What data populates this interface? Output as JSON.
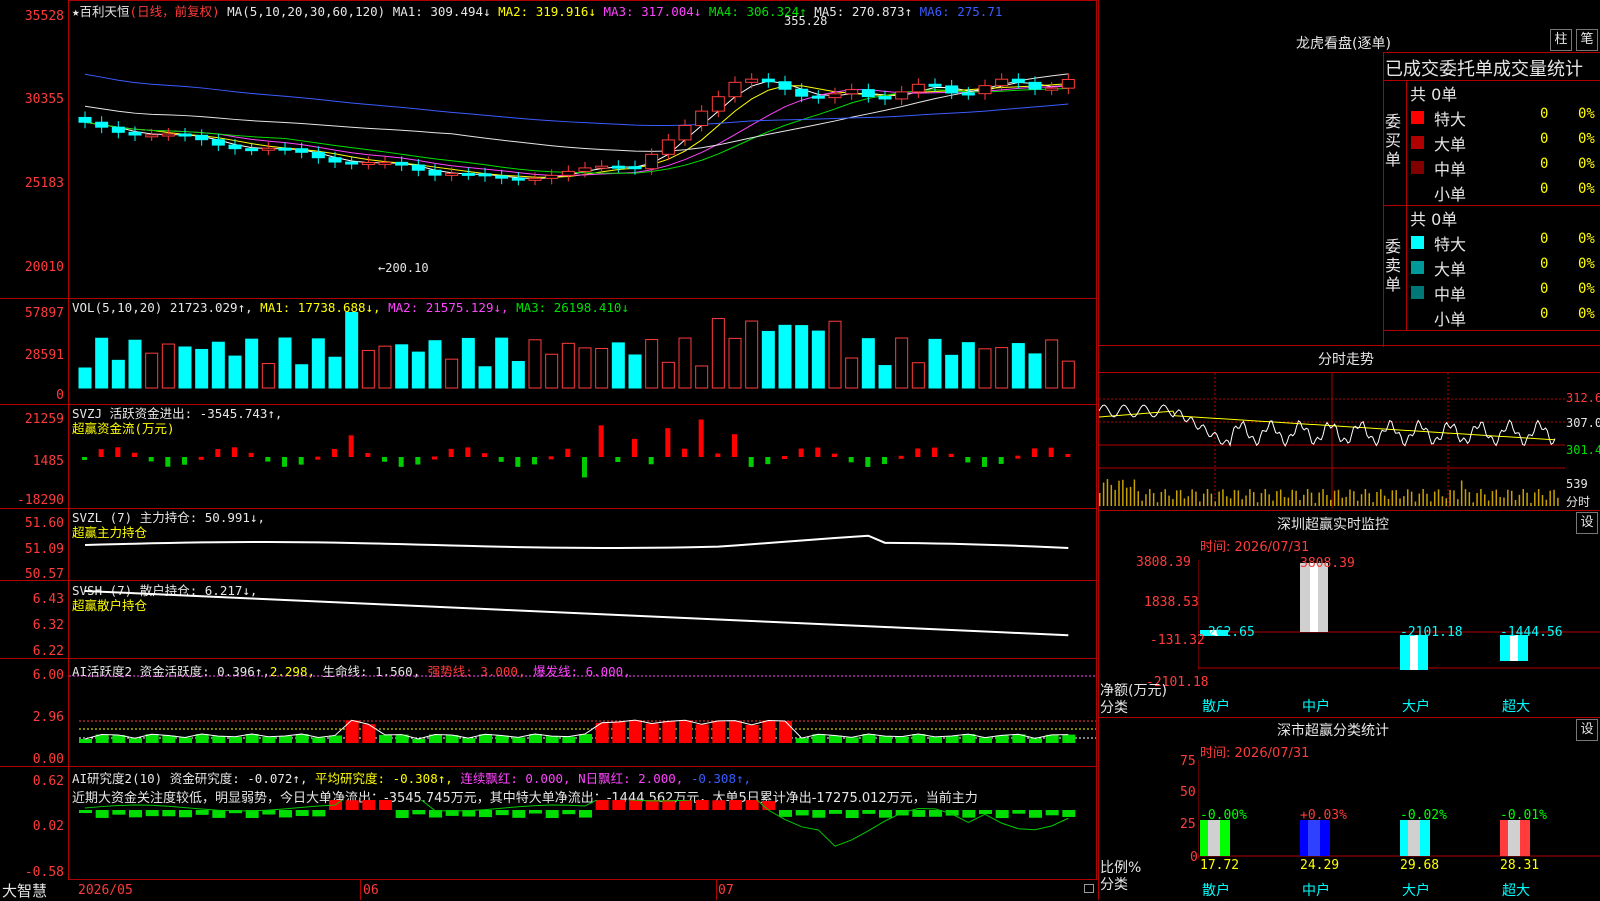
{
  "main": {
    "title": "百利天恒",
    "title_mode": "(日线，前复权)",
    "ma_label": "MA(5,10,20,30,60,120)",
    "ma1": "MA1: 309.494↓",
    "ma2": "MA2: 319.916↓",
    "ma3": "MA3: 317.004↓",
    "ma4": "MA4: 306.324↑",
    "ma5": "MA5: 270.873↑",
    "ma6": "MA6: 275.71",
    "y_ticks": [
      "35528",
      "30355",
      "25183",
      "20010"
    ],
    "high_note": "355.28",
    "low_note": "←200.10"
  },
  "vol": {
    "label": "VOL(5,10,20)",
    "value": "21723.029↑,",
    "ma1": "MA1: 17738.688↓,",
    "ma2": "MA2: 21575.129↓,",
    "ma3": "MA3: 26198.410↓",
    "y_ticks": [
      "57897",
      "28591",
      "0"
    ]
  },
  "svzj": {
    "line1": "SVZJ  活跃资金进出: -3545.743↑,",
    "line2": "超赢资金流(万元)",
    "y_ticks": [
      "21259",
      "1485",
      "-18290"
    ]
  },
  "svzl": {
    "line1": "SVZL (7) 主力持仓: 50.991↓,",
    "line2": "超赢主力持仓",
    "y_ticks": [
      "51.60",
      "51.09",
      "50.57"
    ]
  },
  "svsh": {
    "line1": "SVSH (7) 散户持仓: 6.217↓,",
    "line2": "超赢散户持仓",
    "y_ticks": [
      "6.43",
      "6.32",
      "6.22"
    ]
  },
  "ai1": {
    "name": "AI活跃度2",
    "a": "资金活跃度: 0.396↑,",
    "b": "2.298,",
    "c": "生命线: 1.560,",
    "d": "强势线: 3.000,",
    "e": "爆发线: 6.000,",
    "y_ticks": [
      "6.00",
      "2.96",
      "0.00"
    ]
  },
  "ai2": {
    "name": "AI研究度2(10)",
    "a": "资金研究度: -0.072↑,",
    "b": "平均研究度: -0.308↑,",
    "c": "连续飘红: 0.000,",
    "d": "N日飘红: 2.000,",
    "e": "-0.308↑,",
    "comment": "近期大资金关注度较低，明显弱势，今日大单净流出：-3545.745万元，其中特大单净流出：-1444.562万元，大单5日累计净出-17275.012万元，当前主力",
    "y_ticks": [
      "0.62",
      "0.02",
      "-0.58"
    ]
  },
  "xaxis": {
    "brand": "大智慧",
    "labels": [
      "2026/05",
      "06",
      "07"
    ]
  },
  "dragon": {
    "title": "龙虎看盘(逐单)",
    "btn1": "柱",
    "btn2": "笔",
    "tabs": "已成交委托单成交量统计",
    "buy_side": "委买单",
    "sell_side": "委卖单",
    "buy_total": "共 0单",
    "sell_total": "共 0单",
    "buy_rows": [
      {
        "name": "特大",
        "n": "0",
        "p": "0%"
      },
      {
        "name": "大单",
        "n": "0",
        "p": "0%"
      },
      {
        "name": "中单",
        "n": "0",
        "p": "0%"
      },
      {
        "name": "小单",
        "n": "0",
        "p": "0%"
      }
    ],
    "sell_rows": [
      {
        "name": "特大",
        "n": "0",
        "p": "0%"
      },
      {
        "name": "大单",
        "n": "0",
        "p": "0%"
      },
      {
        "name": "中单",
        "n": "0",
        "p": "0%"
      },
      {
        "name": "小单",
        "n": "0",
        "p": "0%"
      }
    ],
    "buy_colors": [
      "#ff0000",
      "#b00000",
      "#800000"
    ],
    "sell_colors": [
      "#00ffff",
      "#009999",
      "#007777"
    ]
  },
  "intraday": {
    "title": "分时走势",
    "y_ticks": [
      "312.6",
      "307.0",
      "301.4",
      "539",
      "分时"
    ]
  },
  "monitor": {
    "title": "深圳超赢实时监控",
    "btn": "设",
    "time": "时间: 2026/07/31",
    "y_ticks": [
      "3808.39",
      "1838.53",
      "-131.32",
      "-2101.18"
    ],
    "values": [
      "-262.65",
      "3808.39",
      "-2101.18",
      "-1444.56"
    ],
    "axis_label": "净额(万元)",
    "axis_label2": "分类",
    "categories": [
      "散户",
      "中户",
      "大户",
      "超大"
    ]
  },
  "classify": {
    "title": "深市超赢分类统计",
    "btn": "设",
    "time": "时间: 2026/07/31",
    "y_ticks": [
      "75",
      "50",
      "25",
      "0"
    ],
    "changes": [
      "-0.00%",
      "+0.03%",
      "-0.02%",
      "-0.01%"
    ],
    "values": [
      "17.72",
      "24.29",
      "29.68",
      "28.31"
    ],
    "axis_label": "比例%",
    "axis_label2": "分类",
    "categories": [
      "散户",
      "中户",
      "大户",
      "超大"
    ]
  }
}
